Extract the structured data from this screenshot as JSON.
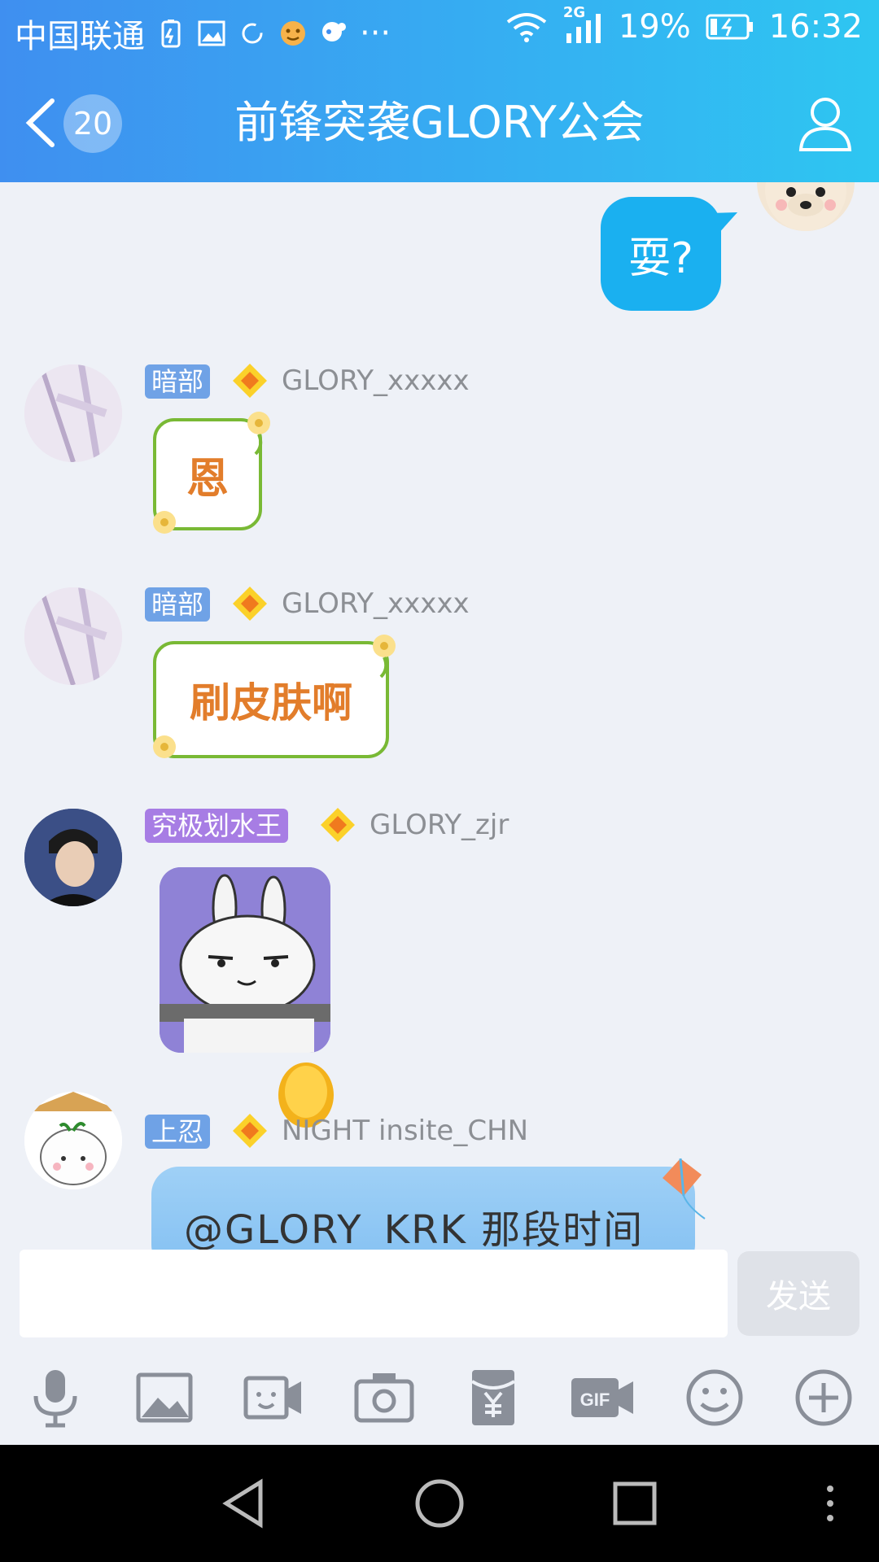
{
  "status_bar": {
    "carrier": "中国联通",
    "network": "2G",
    "battery": "19%",
    "time": "16:32",
    "more": "···"
  },
  "header": {
    "back_count": "20",
    "title": "前锋突袭GLORY公会"
  },
  "messages": [
    {
      "side": "right",
      "text": "耍?"
    },
    {
      "side": "left",
      "tag": "暗部",
      "tag_color": "#6fa2e6",
      "username": "GLORY_xxxxx",
      "text": "恩"
    },
    {
      "side": "left",
      "tag": "暗部",
      "tag_color": "#6fa2e6",
      "username": "GLORY_xxxxx",
      "text": "刷皮肤啊"
    },
    {
      "side": "left",
      "tag": "究极划水王",
      "tag_color": "#a77de4",
      "username": "GLORY_zjr",
      "sticker": "bunny-sticker"
    },
    {
      "side": "left",
      "tag": "上忍",
      "tag_color": "#6fa2e6",
      "username": "NIGHT insite_CHN",
      "text": "@GLORY_KRK 那段时间"
    }
  ],
  "input": {
    "placeholder": "",
    "send_label": "发送"
  },
  "toolbar_icons": [
    "mic-icon",
    "image-icon",
    "video-icon",
    "camera-icon",
    "red-packet-icon",
    "gif-icon",
    "emoji-icon",
    "plus-icon"
  ],
  "colors": {
    "header_start": "#3f8ff0",
    "header_end": "#2ec6f1",
    "my_bubble": "#1ab0f0",
    "background": "#eef1f7",
    "flower_border": "#79b935",
    "flower_text": "#e27d2b"
  }
}
